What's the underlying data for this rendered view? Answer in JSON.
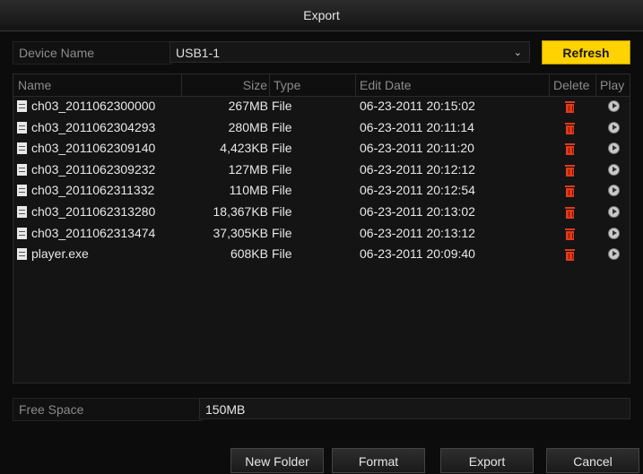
{
  "window": {
    "title": "Export"
  },
  "device": {
    "label": "Device Name",
    "value": "USB1-1"
  },
  "refresh_label": "Refresh",
  "table": {
    "columns": {
      "name": "Name",
      "size": "Size",
      "type": "Type",
      "edit_date": "Edit Date",
      "delete": "Delete",
      "play": "Play"
    },
    "rows": [
      {
        "name": "ch03_2011062300000",
        "size": "267MB",
        "type": "File",
        "edit_date": "06-23-2011 20:15:02"
      },
      {
        "name": "ch03_2011062304293",
        "size": "280MB",
        "type": "File",
        "edit_date": "06-23-2011 20:11:14"
      },
      {
        "name": "ch03_2011062309140",
        "size": "4,423KB",
        "type": "File",
        "edit_date": "06-23-2011 20:11:20"
      },
      {
        "name": "ch03_2011062309232",
        "size": "127MB",
        "type": "File",
        "edit_date": "06-23-2011 20:12:12"
      },
      {
        "name": "ch03_2011062311332",
        "size": "110MB",
        "type": "File",
        "edit_date": "06-23-2011 20:12:54"
      },
      {
        "name": "ch03_2011062313280",
        "size": "18,367KB",
        "type": "File",
        "edit_date": "06-23-2011 20:13:02"
      },
      {
        "name": "ch03_2011062313474",
        "size": "37,305KB",
        "type": "File",
        "edit_date": "06-23-2011 20:13:12"
      },
      {
        "name": "player.exe",
        "size": "608KB",
        "type": "File",
        "edit_date": "06-23-2011 20:09:40"
      }
    ]
  },
  "free_space": {
    "label": "Free Space",
    "value": "150MB"
  },
  "buttons": {
    "new_folder": "New Folder",
    "format": "Format",
    "export": "Export",
    "cancel": "Cancel"
  },
  "colors": {
    "refresh": "#ffd200",
    "delete_icon": "#e03a1a",
    "background": "#0c0c0c"
  },
  "icons": {
    "file": "file-icon",
    "delete": "trash-icon",
    "play": "play-icon",
    "dropdown": "chevron-down-icon"
  }
}
